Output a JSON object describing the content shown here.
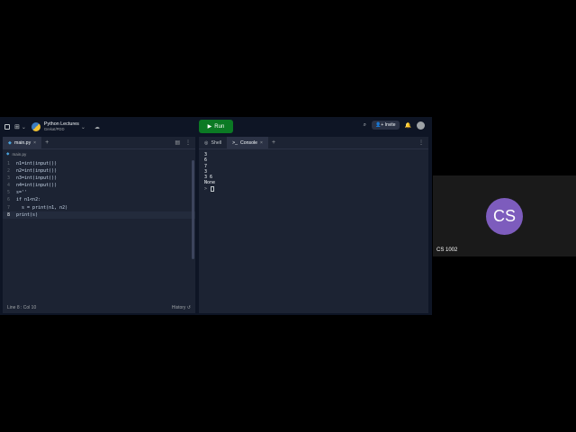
{
  "topbar": {
    "project_title": "Python Lectures",
    "project_subtitle": "Grekat/PDD",
    "run_label": "Run",
    "invite_label": "Invite"
  },
  "editor": {
    "tab_label": "main.py",
    "breadcrumb": "main.py",
    "lines": [
      {
        "num": "1",
        "code": "n1=int(input())"
      },
      {
        "num": "2",
        "code": "n2=int(input())"
      },
      {
        "num": "3",
        "code": "n3=int(input())"
      },
      {
        "num": "4",
        "code": "n4=int(input())"
      },
      {
        "num": "5",
        "code": "s=''"
      },
      {
        "num": "6",
        "code": "if n1<n2:"
      },
      {
        "num": "7",
        "code": "  s = print(n1, n2)"
      },
      {
        "num": "8",
        "code": "print(s)"
      }
    ],
    "status_position": "Line 8 : Col 10",
    "history_label": "History"
  },
  "console": {
    "shell_tab": "Shell",
    "console_tab": "Console",
    "output": [
      "3",
      "6",
      "7",
      "3",
      "3 6",
      "None"
    ],
    "prompt": ">"
  },
  "meeting": {
    "initials": "CS",
    "participant_name": "CS 1002",
    "avatar_color": "#7d5cbd"
  }
}
